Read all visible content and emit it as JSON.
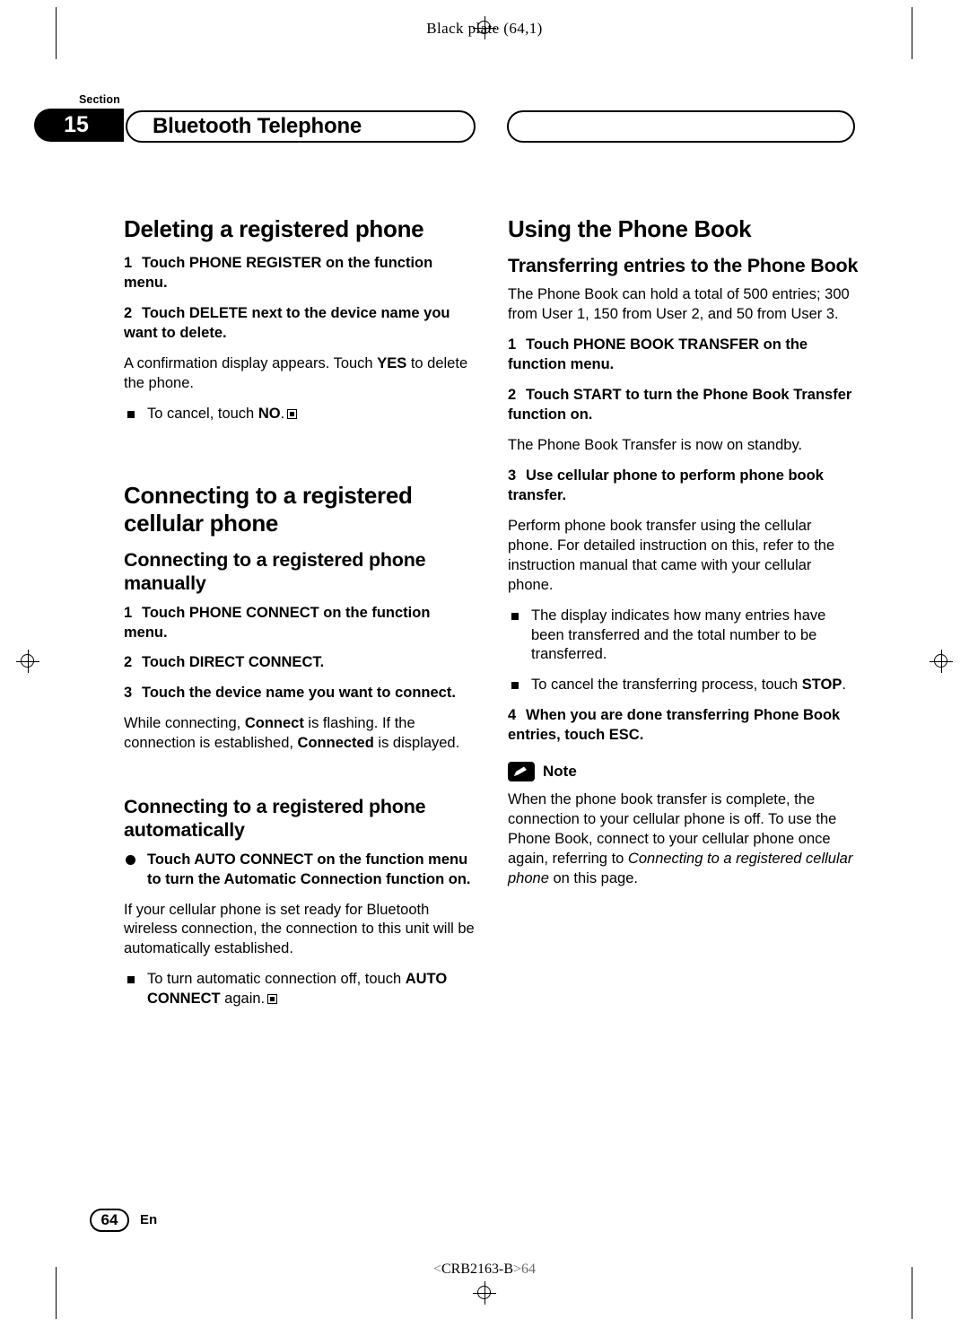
{
  "header": {
    "black_plate": "Black plate (64,1)",
    "section_word": "Section",
    "section_number": "15",
    "chapter_title": "Bluetooth Telephone"
  },
  "left_column": {
    "heading1": "Deleting a registered phone",
    "steps1": [
      {
        "num": "1",
        "text": "Touch PHONE REGISTER on the function menu."
      },
      {
        "num": "2",
        "text": "Touch DELETE next to the device name you want to delete."
      }
    ],
    "body1_a": "A confirmation display appears. Touch ",
    "body1_b": "YES",
    "body1_c": " to delete the phone.",
    "bullet1_a": "To cancel, touch ",
    "bullet1_b": "NO",
    "bullet1_c": ".",
    "heading2": "Connecting to a registered cellular phone",
    "subhead2a": "Connecting to a registered phone manually",
    "steps2": [
      {
        "num": "1",
        "text": "Touch PHONE CONNECT on the function menu."
      },
      {
        "num": "2",
        "text": "Touch DIRECT CONNECT."
      },
      {
        "num": "3",
        "text": "Touch the device name you want to connect."
      }
    ],
    "body2_a": "While connecting, ",
    "body2_b": "Connect",
    "body2_c": " is flashing. If the connection is established, ",
    "body2_d": "Connected",
    "body2_e": " is displayed.",
    "subhead2b": "Connecting to a registered phone automatically",
    "bullet2_strong": "Touch AUTO CONNECT on the function menu to turn the Automatic Connection function on.",
    "body3": "If your cellular phone is set ready for Bluetooth wireless connection, the connection to this unit will be automatically established.",
    "bullet3_a": "To turn automatic connection off, touch ",
    "bullet3_b": "AUTO CONNECT",
    "bullet3_c": " again."
  },
  "right_column": {
    "heading1": "Using the Phone Book",
    "subhead1": "Transferring entries to the Phone Book",
    "body1": "The Phone Book can hold a total of 500 entries; 300 from User 1, 150 from User 2, and 50 from User 3.",
    "steps": [
      {
        "num": "1",
        "text": "Touch PHONE BOOK TRANSFER on the function menu."
      },
      {
        "num": "2",
        "text": "Touch START to turn the Phone Book Transfer function on."
      },
      {
        "num": "3",
        "text": "Use cellular phone to perform phone book transfer."
      },
      {
        "num": "4",
        "text": "When you are done transferring Phone Book entries, touch ESC."
      }
    ],
    "body2": "The Phone Book Transfer is now on standby.",
    "body3": "Perform phone book transfer using the cellular phone. For detailed instruction on this, refer to the instruction manual that came with your cellular phone.",
    "bullet1": "The display indicates how many entries have been transferred and the total number to be transferred.",
    "bullet2_a": "To cancel the transferring process, touch ",
    "bullet2_b": "STOP",
    "bullet2_c": ".",
    "note_label": "Note",
    "note_a": "When the phone book transfer is complete, the connection to your cellular phone is off. To use the Phone Book, connect to your cellular phone once again, referring to ",
    "note_b": "Connecting to a registered cellular phone",
    "note_c": " on this page."
  },
  "footer": {
    "page_number": "64",
    "language": "En",
    "code_prefix": "<",
    "code": "CRB2163-B",
    "code_suffix": ">64"
  }
}
